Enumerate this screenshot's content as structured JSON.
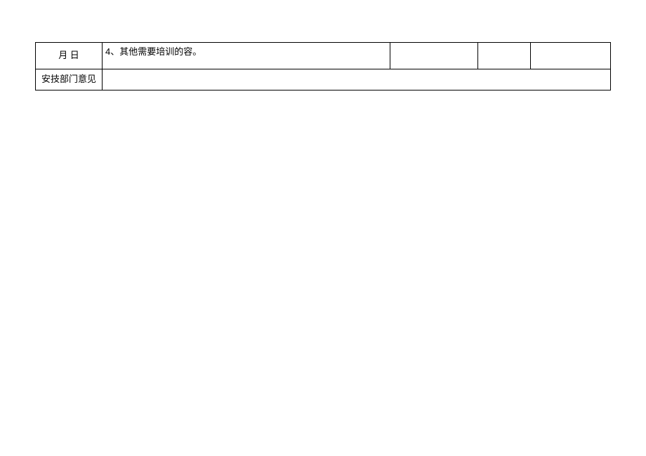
{
  "table": {
    "row1": {
      "date_label": "月  日",
      "content": "4、其他需要培训的容。",
      "c3": "",
      "c4": "",
      "c5": ""
    },
    "row2": {
      "label": "安技部门意见",
      "content": ""
    }
  }
}
